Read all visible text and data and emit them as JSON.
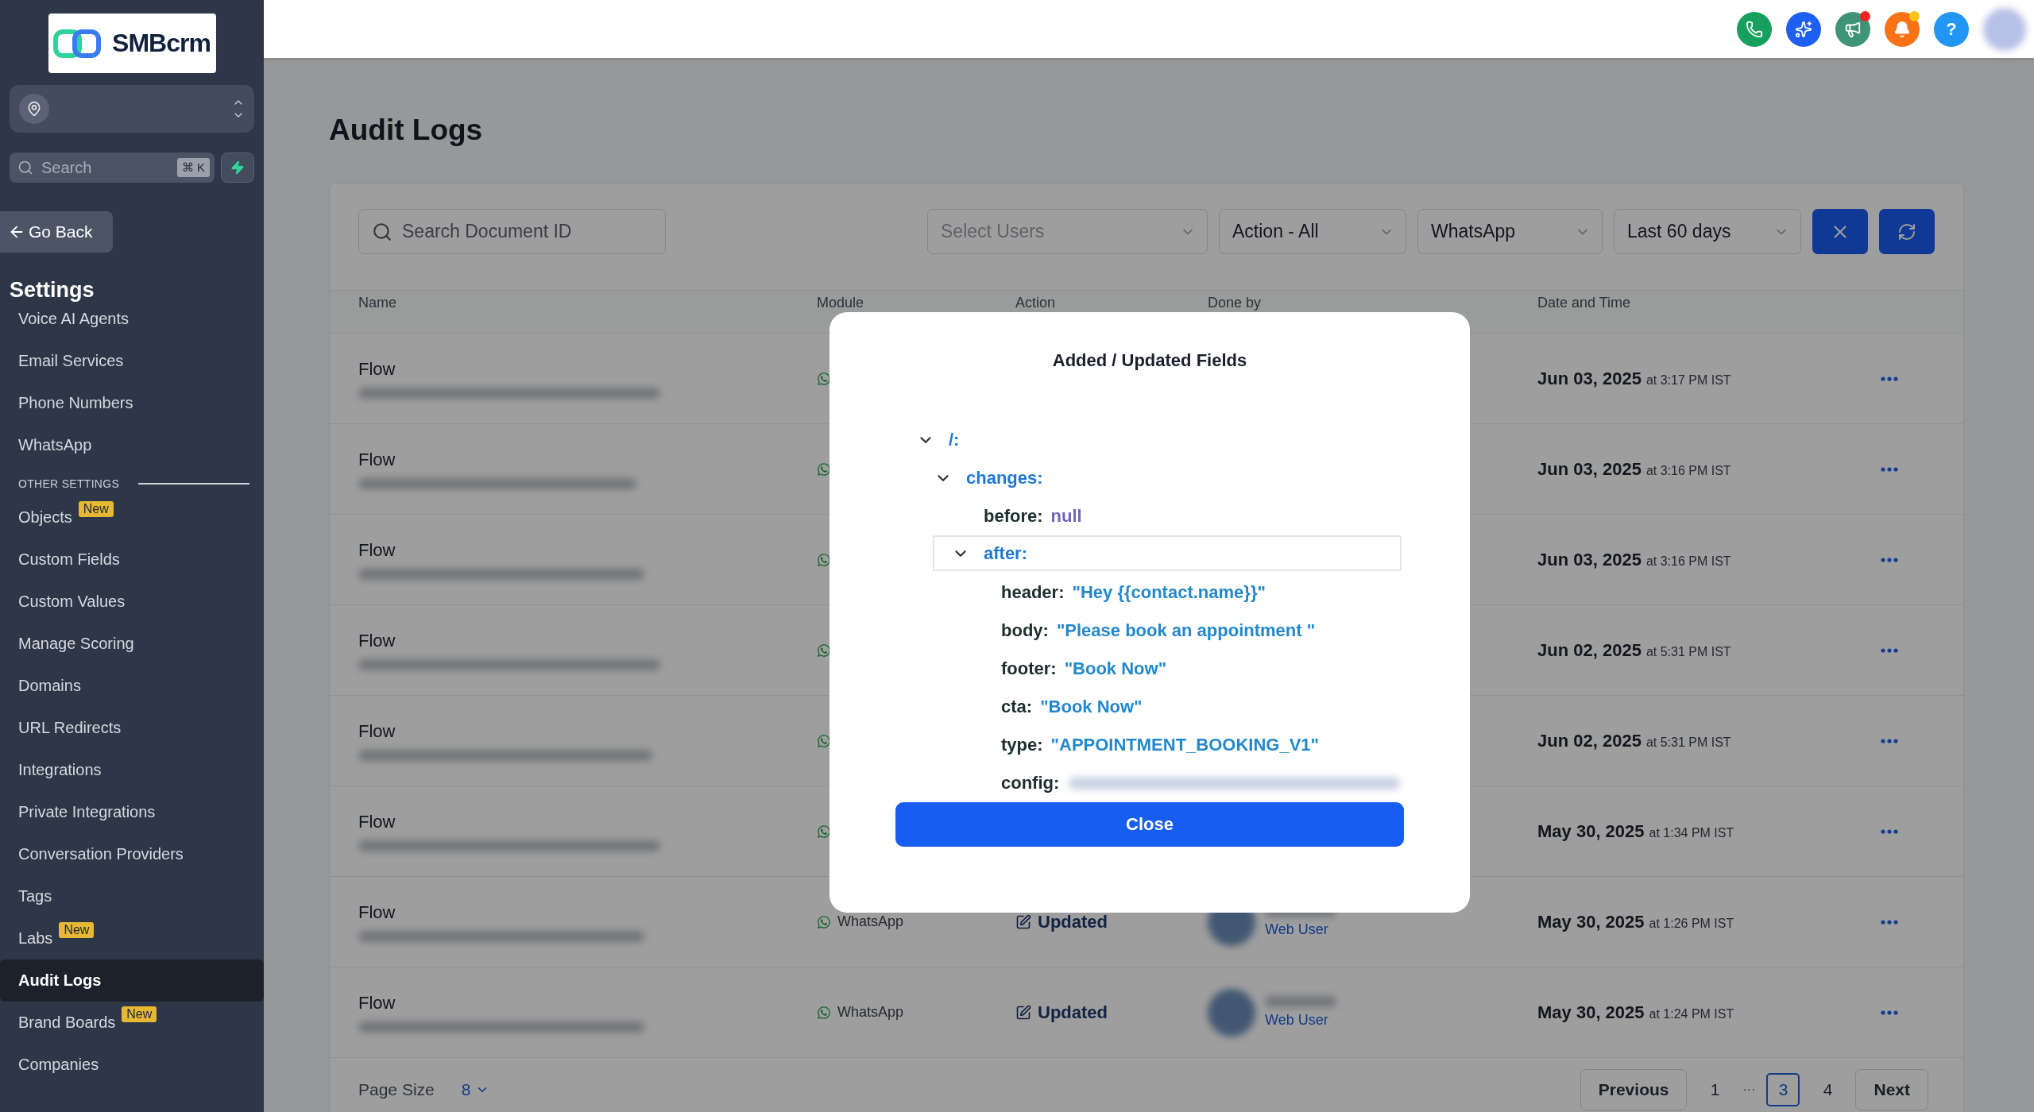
{
  "sidebar": {
    "logo": "SMBcrm",
    "search": {
      "placeholder": "Search",
      "shortcut": "⌘ K"
    },
    "back": "Go Back",
    "title": "Settings",
    "groups": [
      {
        "kind": "plain",
        "items": [
          {
            "label": "Voice AI Agents",
            "selected": false
          },
          {
            "label": "Email Services",
            "selected": false
          },
          {
            "label": "Phone Numbers",
            "selected": false
          },
          {
            "label": "WhatsApp",
            "selected": false
          }
        ]
      },
      {
        "kind": "labeled",
        "heading": "OTHER SETTINGS",
        "items": [
          {
            "label": "Objects",
            "badge": "New",
            "selected": false
          },
          {
            "label": "Custom Fields",
            "selected": false
          },
          {
            "label": "Custom Values",
            "selected": false
          },
          {
            "label": "Manage Scoring",
            "selected": false
          },
          {
            "label": "Domains",
            "selected": false
          },
          {
            "label": "URL Redirects",
            "selected": false
          },
          {
            "label": "Integrations",
            "selected": false
          },
          {
            "label": "Private Integrations",
            "selected": false
          },
          {
            "label": "Conversation Providers",
            "selected": false
          },
          {
            "label": "Tags",
            "selected": false
          },
          {
            "label": "Labs",
            "badge": "New",
            "selected": false
          },
          {
            "label": "Audit Logs",
            "selected": true
          },
          {
            "label": "Brand Boards",
            "badge": "New",
            "selected": false
          },
          {
            "label": "Companies",
            "selected": false
          }
        ]
      }
    ]
  },
  "topbar": {
    "buttons": [
      {
        "kind": "phone",
        "color": "#16a05c"
      },
      {
        "kind": "sparkle",
        "color": "#1d5ff0"
      },
      {
        "kind": "megaphone",
        "color": "#3f9478",
        "dot": {
          "color": "#ef2222"
        }
      },
      {
        "kind": "bell",
        "color": "#f97316",
        "dot": {
          "color": "#f5c518"
        }
      },
      {
        "kind": "help",
        "color": "#2196f3",
        "label": "?"
      },
      {
        "kind": "avatar",
        "color": "#b7c0e6"
      }
    ]
  },
  "page": {
    "title": "Audit Logs"
  },
  "filters": {
    "search": {
      "placeholder": "Search Document ID"
    },
    "selects": [
      {
        "placeholder": "Select Users"
      },
      {
        "value": "Action - All"
      },
      {
        "value": "WhatsApp"
      },
      {
        "value": "Last 60 days"
      }
    ]
  },
  "table": {
    "columns": [
      "Name",
      "Module",
      "Action",
      "Done by",
      "Date and Time"
    ],
    "rows": [
      {
        "name": "Flow",
        "date": "Jun 03, 2025",
        "time": "at 3:17 PM IST"
      },
      {
        "name": "Flow",
        "date": "Jun 03, 2025",
        "time": "at 3:16 PM IST"
      },
      {
        "name": "Flow",
        "date": "Jun 03, 2025",
        "time": "at 3:16 PM IST"
      },
      {
        "name": "Flow",
        "date": "Jun 02, 2025",
        "time": "at 5:31 PM IST"
      },
      {
        "name": "Flow",
        "date": "Jun 02, 2025",
        "time": "at 5:31 PM IST"
      },
      {
        "name": "Flow",
        "date": "May 30, 2025",
        "time": "at 1:34 PM IST"
      },
      {
        "name": "Flow",
        "module": "WhatsApp",
        "action": "Updated",
        "done_by": "Web User",
        "date": "May 30, 2025",
        "time": "at 1:26 PM IST"
      },
      {
        "name": "Flow",
        "module": "WhatsApp",
        "action": "Updated",
        "done_by": "Web User",
        "date": "May 30, 2025",
        "time": "at 1:24 PM IST"
      }
    ]
  },
  "pagination": {
    "page_size_label": "Page Size",
    "page_size": "8",
    "previous": "Previous",
    "next": "Next",
    "pages": [
      {
        "kind": "page",
        "label": "1",
        "selected": false
      },
      {
        "kind": "gap",
        "label": "···"
      },
      {
        "kind": "page",
        "label": "3",
        "selected": true
      },
      {
        "kind": "page",
        "label": "4",
        "selected": false
      }
    ]
  },
  "modal": {
    "title": "Added / Updated Fields",
    "close": "Close",
    "tree": [
      {
        "key": "/:",
        "expanded": true,
        "selected": false,
        "children": [
          {
            "key": "changes:",
            "expanded": true,
            "selected": false,
            "children": [
              {
                "key": "before:",
                "kind": "null",
                "value": "null",
                "selected": false
              },
              {
                "key": "after:",
                "expanded": true,
                "selected": true,
                "children": [
                  {
                    "key": "header:",
                    "kind": "string",
                    "value": "\"Hey {{contact.name}}\"",
                    "selected": false
                  },
                  {
                    "key": "body:",
                    "kind": "string",
                    "value": "\"Please book an appointment \"",
                    "selected": false
                  },
                  {
                    "key": "footer:",
                    "kind": "string",
                    "value": "\"Book Now\"",
                    "selected": false
                  },
                  {
                    "key": "cta:",
                    "kind": "string",
                    "value": "\"Book Now\"",
                    "selected": false
                  },
                  {
                    "key": "type:",
                    "kind": "string",
                    "value": "\"APPOINTMENT_BOOKING_V1\"",
                    "selected": false
                  },
                  {
                    "key": "config:",
                    "kind": "redacted",
                    "selected": false
                  }
                ]
              }
            ]
          }
        ]
      }
    ]
  }
}
